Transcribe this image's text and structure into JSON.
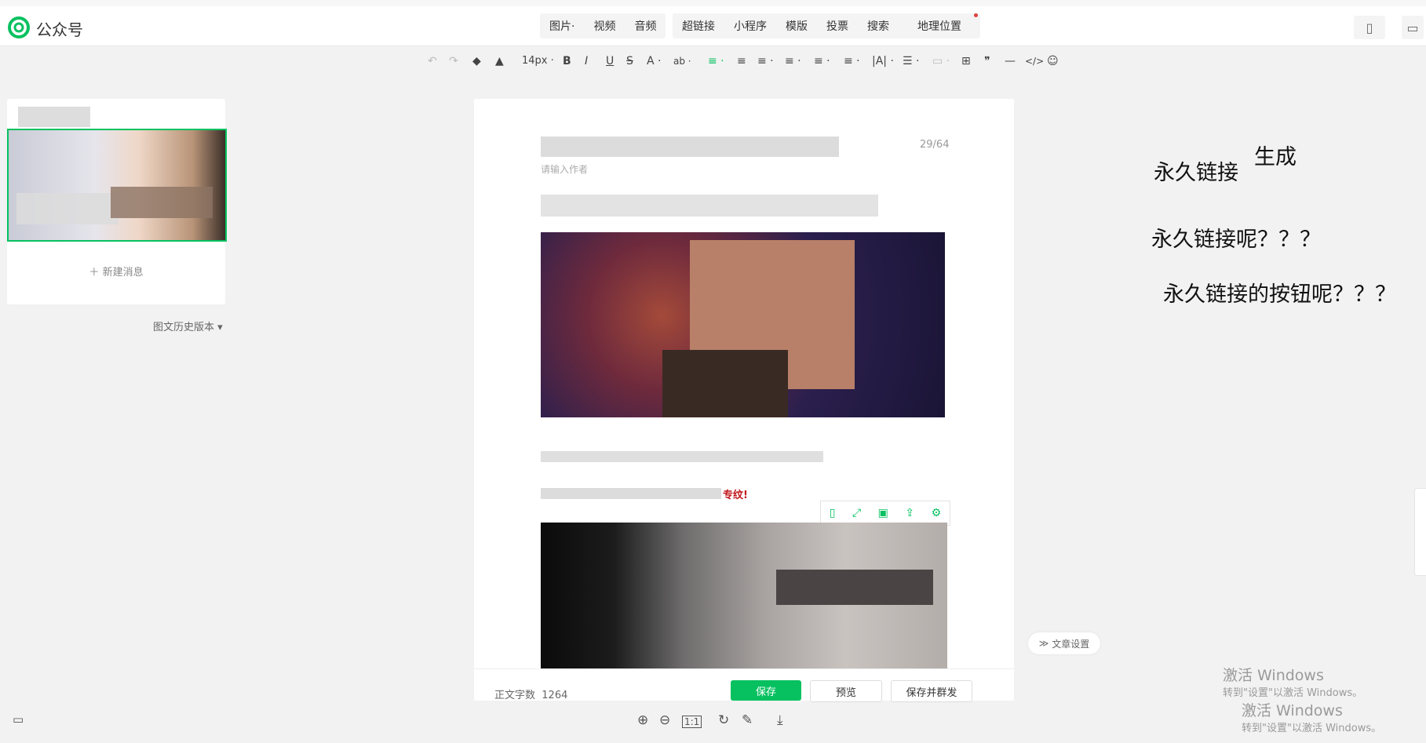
{
  "app": {
    "brand": "公众号"
  },
  "header_menu": {
    "group1": [
      "图片·",
      "视频",
      "音频"
    ],
    "group2": [
      "超链接",
      "小程序",
      "模版",
      "投票",
      "搜索",
      "地理位置"
    ]
  },
  "toolbar": {
    "undo": "↶",
    "redo": "↷",
    "format_brush": "◆",
    "clear": "▲",
    "font_size": "14px ·",
    "bold": "B",
    "italic": "I",
    "underline": "U",
    "strike": "S",
    "font_color": "A ·",
    "bg_color": "ab ·",
    "align_left": "≡ ·",
    "align_center": "≡",
    "align_right": "≡ ·",
    "indent": "≡ ·",
    "line_height": "≡ ·",
    "spacing": "≡ ·",
    "letter_spacing": "|A| ·",
    "list": "☰ ·",
    "table": "⊞",
    "quote": "❞",
    "divider": "—",
    "code": "</>",
    "emoji": "☺"
  },
  "sidebar": {
    "new_message": "新建消息",
    "history": "图文历史版本"
  },
  "editor": {
    "title_counter": "29/64",
    "author_placeholder": "请输入作者",
    "red_text": "专纹!",
    "word_count_label": "正文字数",
    "word_count": "1264"
  },
  "buttons": {
    "save": "保存",
    "preview": "预览",
    "save_send": "保存并群发"
  },
  "article_settings": "文章设置",
  "annotations": [
    {
      "text": "生成"
    },
    {
      "text": "永久链接"
    },
    {
      "text": "永久链接呢？？？"
    },
    {
      "text": "永久链接的按钮呢？？？"
    }
  ],
  "watermark": [
    {
      "title": "激活 Windows",
      "sub": "转到\"设置\"以激活 Windows。"
    },
    {
      "title": "激活 Windows",
      "sub": "转到\"设置\"以激活 Windows。"
    }
  ],
  "colors": {
    "accent": "#07c160",
    "danger": "#e0403c"
  }
}
